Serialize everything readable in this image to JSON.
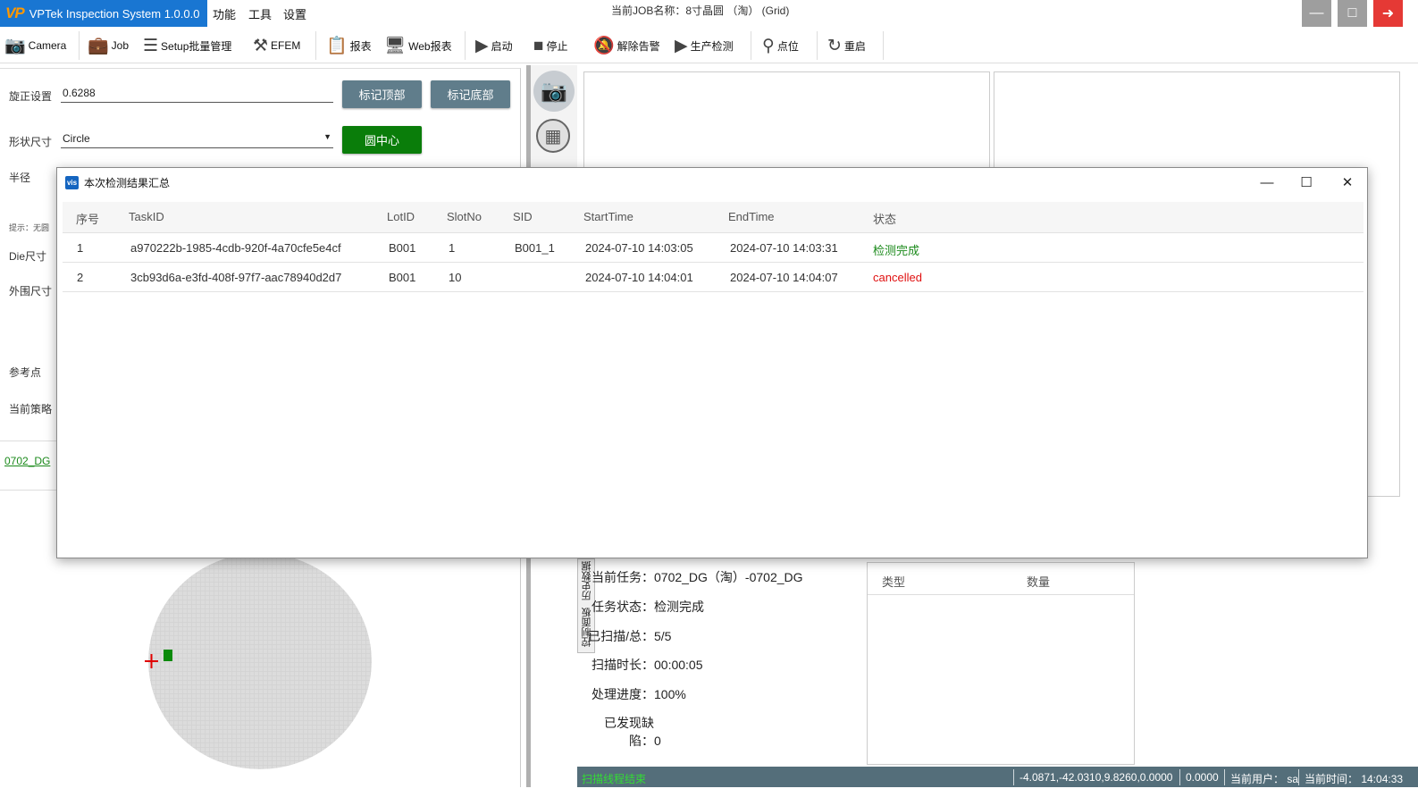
{
  "app": {
    "title": "VPTek Inspection System 1.0.0.0",
    "logo": "VP",
    "menus": [
      "功能",
      "工具",
      "设置"
    ],
    "job_title": "当前JOB名称：8寸晶圆 （淘） (Grid)"
  },
  "toolbar": {
    "items": [
      {
        "label": "Camera",
        "icon": "camera-icon"
      },
      {
        "label": "Job",
        "icon": "briefcase-icon"
      },
      {
        "label": "Setup批量管理",
        "icon": "checklist-icon"
      },
      {
        "label": "EFEM",
        "icon": "robot-arm-icon"
      },
      {
        "label": "报表",
        "icon": "report-icon"
      },
      {
        "label": "Web报表",
        "icon": "monitor-icon"
      },
      {
        "label": "启动",
        "icon": "play-icon"
      },
      {
        "label": "停止",
        "icon": "stop-icon"
      },
      {
        "label": "解除告警",
        "icon": "bell-off-icon"
      },
      {
        "label": "生产检测",
        "icon": "play-icon"
      },
      {
        "label": "点位",
        "icon": "location-pin-icon"
      },
      {
        "label": "重启",
        "icon": "restart-icon"
      }
    ]
  },
  "left": {
    "rotate_label": "旋正设置",
    "rotate_value": "0.6288",
    "mark_top": "标记顶部",
    "mark_bottom": "标记底部",
    "shape_label": "形状尺寸",
    "shape_value": "Circle",
    "circle_center": "圆中心",
    "radius_label": "半径",
    "hint": "提示：无圆",
    "die_label": "Die尺寸",
    "outer_label": "外围尺寸",
    "ref_label": "参考点",
    "strategy_label": "当前策略",
    "job_link": "0702_DG"
  },
  "dialog": {
    "title": "本次检测结果汇总",
    "icon": "vis",
    "columns": [
      "序号",
      "TaskID",
      "LotID",
      "SlotNo",
      "SID",
      "StartTime",
      "EndTime",
      "状态"
    ],
    "rows": [
      [
        "1",
        "a970222b-1985-4cdb-920f-4a70cfe5e4cf",
        "B001",
        "1",
        "B001_1",
        "2024-07-10 14:03:05",
        "2024-07-10 14:03:31",
        "检测完成"
      ],
      [
        "2",
        "3cb93d6a-e3fd-408f-97f7-aac78940d2d7",
        "B001",
        "10",
        "",
        "2024-07-10 14:04:01",
        "2024-07-10 14:04:07",
        "cancelled"
      ]
    ]
  },
  "side_tabs": [
    "历史数据",
    "控制面板"
  ],
  "info": {
    "task_key": "当前任务：",
    "task_val": "0702_DG（淘）-0702_DG",
    "state_key": "任务状态：",
    "state_val": "检测完成",
    "scanned_key": "已扫描/总：",
    "scanned_val": "5/5",
    "duration_key": "扫描时长：",
    "duration_val": "00:00:05",
    "progress_key": "处理进度：",
    "progress_val": "100%",
    "defects_key": "已发现缺陷：",
    "defects_val": "0"
  },
  "defect_table": {
    "type": "类型",
    "count": "数量"
  },
  "status": {
    "message": "扫描线程结束",
    "coords": "-4.0871,-42.0310,9.8260,0.0000",
    "value": "0.0000",
    "user": "当前用户： sa",
    "time": "当前时间： 14:04:33"
  },
  "colors": {
    "brand": "#1976d2",
    "accent_green": "#0a7d0a",
    "status_bar": "#546e7a",
    "button_gray": "#607d8b",
    "close_red": "#e53935"
  }
}
